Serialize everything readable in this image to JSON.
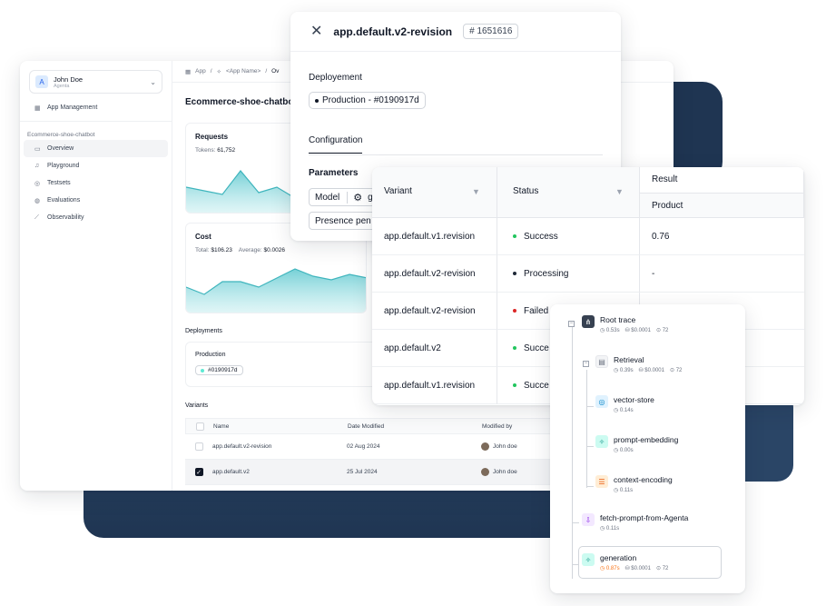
{
  "colors": {
    "accent": "#2c4868",
    "teal": "#7dd3d8",
    "success": "#22c55e",
    "processing": "#1f2937",
    "failed": "#dc2626",
    "deploy_dot": "#5eead4"
  },
  "sidebar": {
    "user_name": "John Doe",
    "org": "Agenta",
    "avatar_letter": "A",
    "app_management": "App Management",
    "project": "Ecommerce-shoe-chatbot",
    "items": [
      {
        "label": "Overview",
        "icon": "monitor-icon"
      },
      {
        "label": "Playground",
        "icon": "bell-icon"
      },
      {
        "label": "Testsets",
        "icon": "database-icon"
      },
      {
        "label": "Evaluations",
        "icon": "target-icon"
      },
      {
        "label": "Observability",
        "icon": "chart-icon"
      }
    ]
  },
  "breadcrumb": {
    "app": "App",
    "name": "<App Name>",
    "sep": "/",
    "current": "Ov"
  },
  "main": {
    "title": "Ecommerce-shoe-chatbo",
    "requests": {
      "title": "Requests",
      "tokens_label": "Tokens:",
      "tokens_value": "61,752"
    },
    "cost": {
      "title": "Cost",
      "total_label": "Total:",
      "total_value": "$106.23",
      "avg_label": "Average:",
      "avg_value": "$0.0026"
    },
    "deployments_label": "Deployments",
    "deployment": {
      "name": "Production",
      "tag": "#0190917d"
    },
    "variants_label": "Variants",
    "variants_headers": [
      "Name",
      "Date Modified",
      "Modified by"
    ],
    "variants": [
      {
        "name": "app.default.v2-revision",
        "date": "02 Aug 2024",
        "by": "John doe",
        "checked": false
      },
      {
        "name": "app.default.v2",
        "date": "25 Jul 2024",
        "by": "John doe",
        "checked": true
      }
    ]
  },
  "drawer": {
    "title": "app.default.v2-revision",
    "tag": "# 1651616",
    "deployment_label": "Deployement",
    "deployment_pill": "Production - #0190917d",
    "tab": "Configuration",
    "parameters_label": "Parameters",
    "param_model": "Model",
    "param_model_value": "g",
    "param_presence": "Presence pen"
  },
  "results": {
    "headers": {
      "variant": "Variant",
      "status": "Status",
      "result": "Result",
      "product": "Product"
    },
    "rows": [
      {
        "variant": "app.default.v1.revision",
        "status": "Success",
        "status_color": "#22c55e",
        "result": "0.76"
      },
      {
        "variant": "app.default.v2-revision",
        "status": "Processing",
        "status_color": "#1f2937",
        "result": "-"
      },
      {
        "variant": "app.default.v2-revision",
        "status": "Failed",
        "status_color": "#dc2626",
        "result": ""
      },
      {
        "variant": "app.default.v2",
        "status": "Succe",
        "status_color": "#22c55e",
        "result": ""
      },
      {
        "variant": "app.default.v1.revision",
        "status": "Succe",
        "status_color": "#22c55e",
        "result": ""
      }
    ]
  },
  "trace": {
    "nodes": [
      {
        "name": "Root trace",
        "time": "0.53s",
        "cost": "$0.0001",
        "tokens": "72"
      },
      {
        "name": "Retrieval",
        "time": "0.39s",
        "cost": "$0.0001",
        "tokens": "72"
      },
      {
        "name": "vector-store",
        "time": "0.14s"
      },
      {
        "name": "prompt-embedding",
        "time": "0.00s"
      },
      {
        "name": "context-encoding",
        "time": "0.11s"
      },
      {
        "name": "fetch-prompt-from-Agenta",
        "time": "0.11s"
      },
      {
        "name": "generation",
        "time": "0.87s",
        "cost": "$0.0001",
        "tokens": "72"
      }
    ]
  },
  "chart_data": [
    {
      "type": "area",
      "title": "Requests",
      "series": [
        {
          "values": [
            30,
            26,
            22,
            48,
            24,
            30,
            18,
            24,
            20,
            26,
            22
          ]
        }
      ]
    },
    {
      "type": "area",
      "title": "Cost",
      "series": [
        {
          "values": [
            30,
            22,
            36,
            36,
            30,
            40,
            50,
            42,
            38,
            44,
            40
          ]
        }
      ]
    }
  ]
}
